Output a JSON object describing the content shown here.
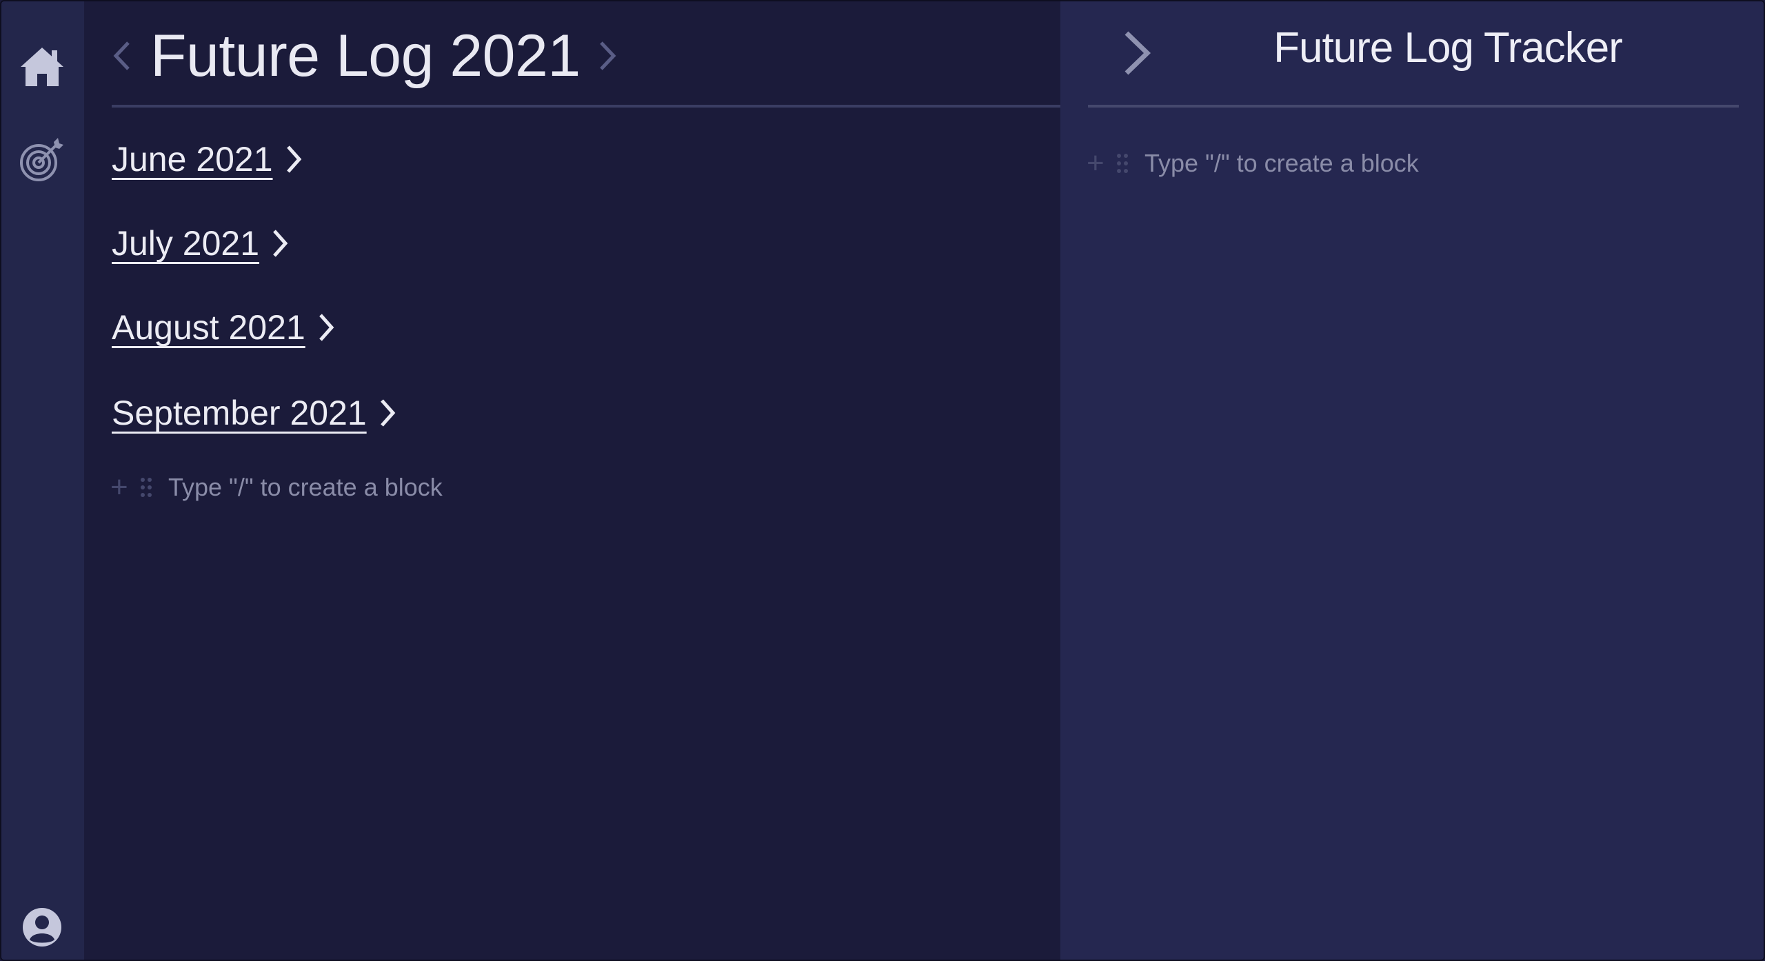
{
  "sidebar": {
    "icons": [
      "home-icon",
      "target-icon",
      "user-icon"
    ]
  },
  "main": {
    "title": "Future Log 2021",
    "prev_icon": "chevron-left-icon",
    "next_icon": "chevron-right-icon",
    "months": [
      {
        "label": "June 2021"
      },
      {
        "label": "July 2021"
      },
      {
        "label": "August 2021"
      },
      {
        "label": "September 2021"
      }
    ],
    "placeholder": "Type \"/\" to create a block"
  },
  "panel": {
    "title": "Future Log Tracker",
    "collapse_icon": "chevron-right-icon",
    "placeholder": "Type \"/\" to create a block"
  },
  "colors": {
    "main_bg": "#1b1b3a",
    "panel_bg": "#252750",
    "rail_bg": "#23264b",
    "text": "#ececf4",
    "muted": "#8a8ca8"
  }
}
